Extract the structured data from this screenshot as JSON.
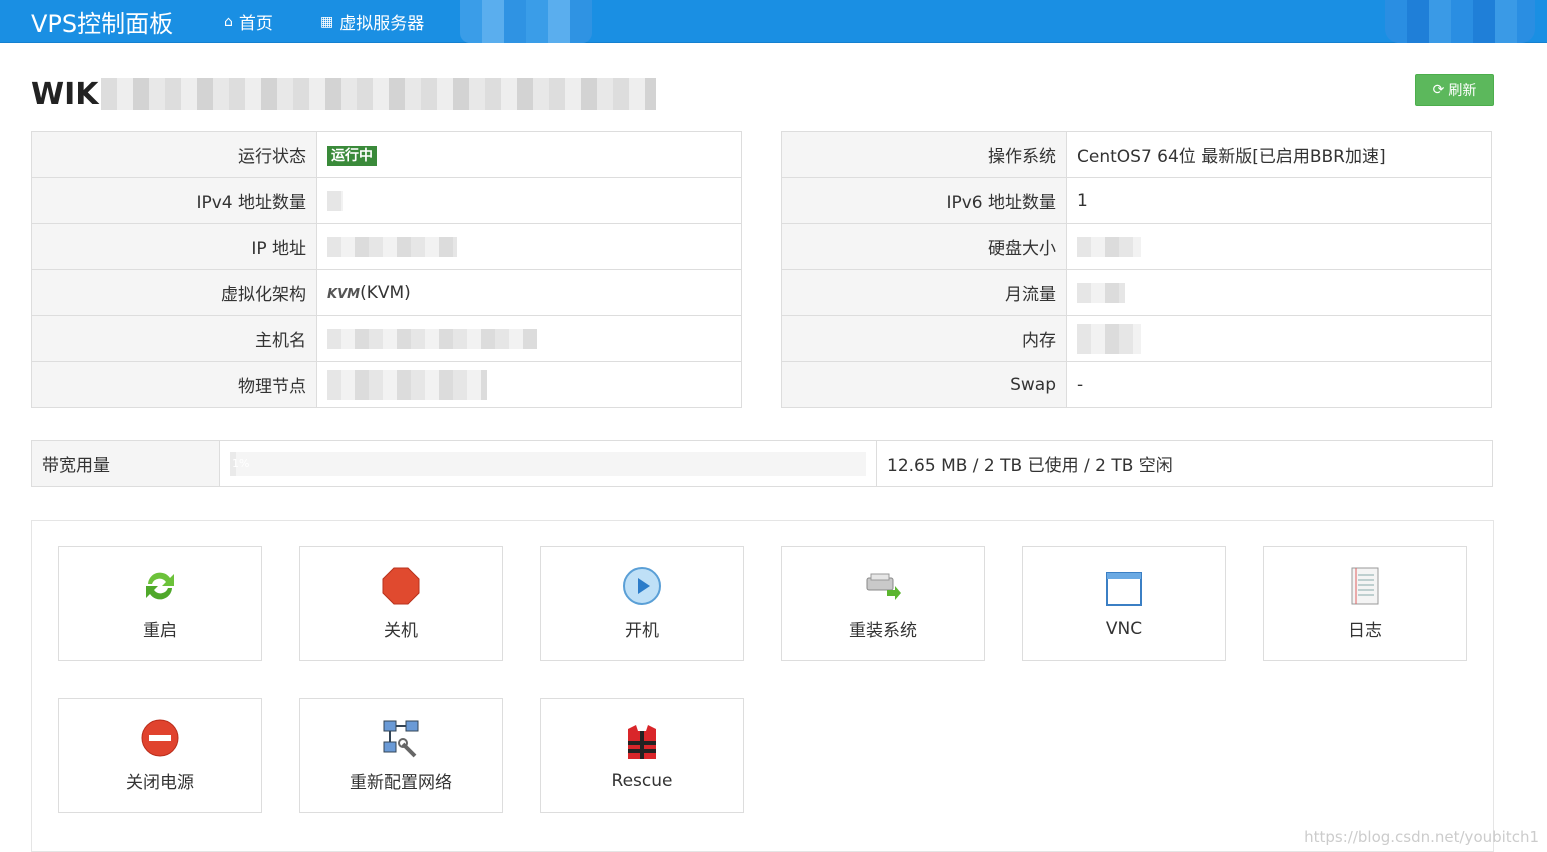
{
  "nav": {
    "brand": "VPS控制面板",
    "home": "首页",
    "servers": "虚拟服务器"
  },
  "title": "WIK",
  "refresh_label": "刷新",
  "left_info": [
    {
      "key": "运行状态",
      "value": "运行中"
    },
    {
      "key": "IPv4 地址数量",
      "value": ""
    },
    {
      "key": "IP 地址",
      "value": ""
    },
    {
      "key": "虚拟化架构",
      "value": "(KVM)"
    },
    {
      "key": "主机名",
      "value": ""
    },
    {
      "key": "物理节点",
      "value": ""
    }
  ],
  "right_info": [
    {
      "key": "操作系统",
      "value": "CentOS7 64位 最新版[已启用BBR加速]"
    },
    {
      "key": "IPv6 地址数量",
      "value": "1"
    },
    {
      "key": "硬盘大小",
      "value": ""
    },
    {
      "key": "月流量",
      "value": ""
    },
    {
      "key": "内存",
      "value": ""
    },
    {
      "key": "Swap",
      "value": "-"
    }
  ],
  "kvm_logo_text": "KVM",
  "bandwidth": {
    "label": "带宽用量",
    "percent_text": "1%",
    "usage_text": "12.65 MB / 2 TB 已使用 / 2 TB 空闲"
  },
  "actions": [
    "重启",
    "关机",
    "开机",
    "重装系统",
    "VNC",
    "日志",
    "关闭电源",
    "重新配置网络",
    "Rescue"
  ],
  "watermark": "https://blog.csdn.net/youbitch1"
}
